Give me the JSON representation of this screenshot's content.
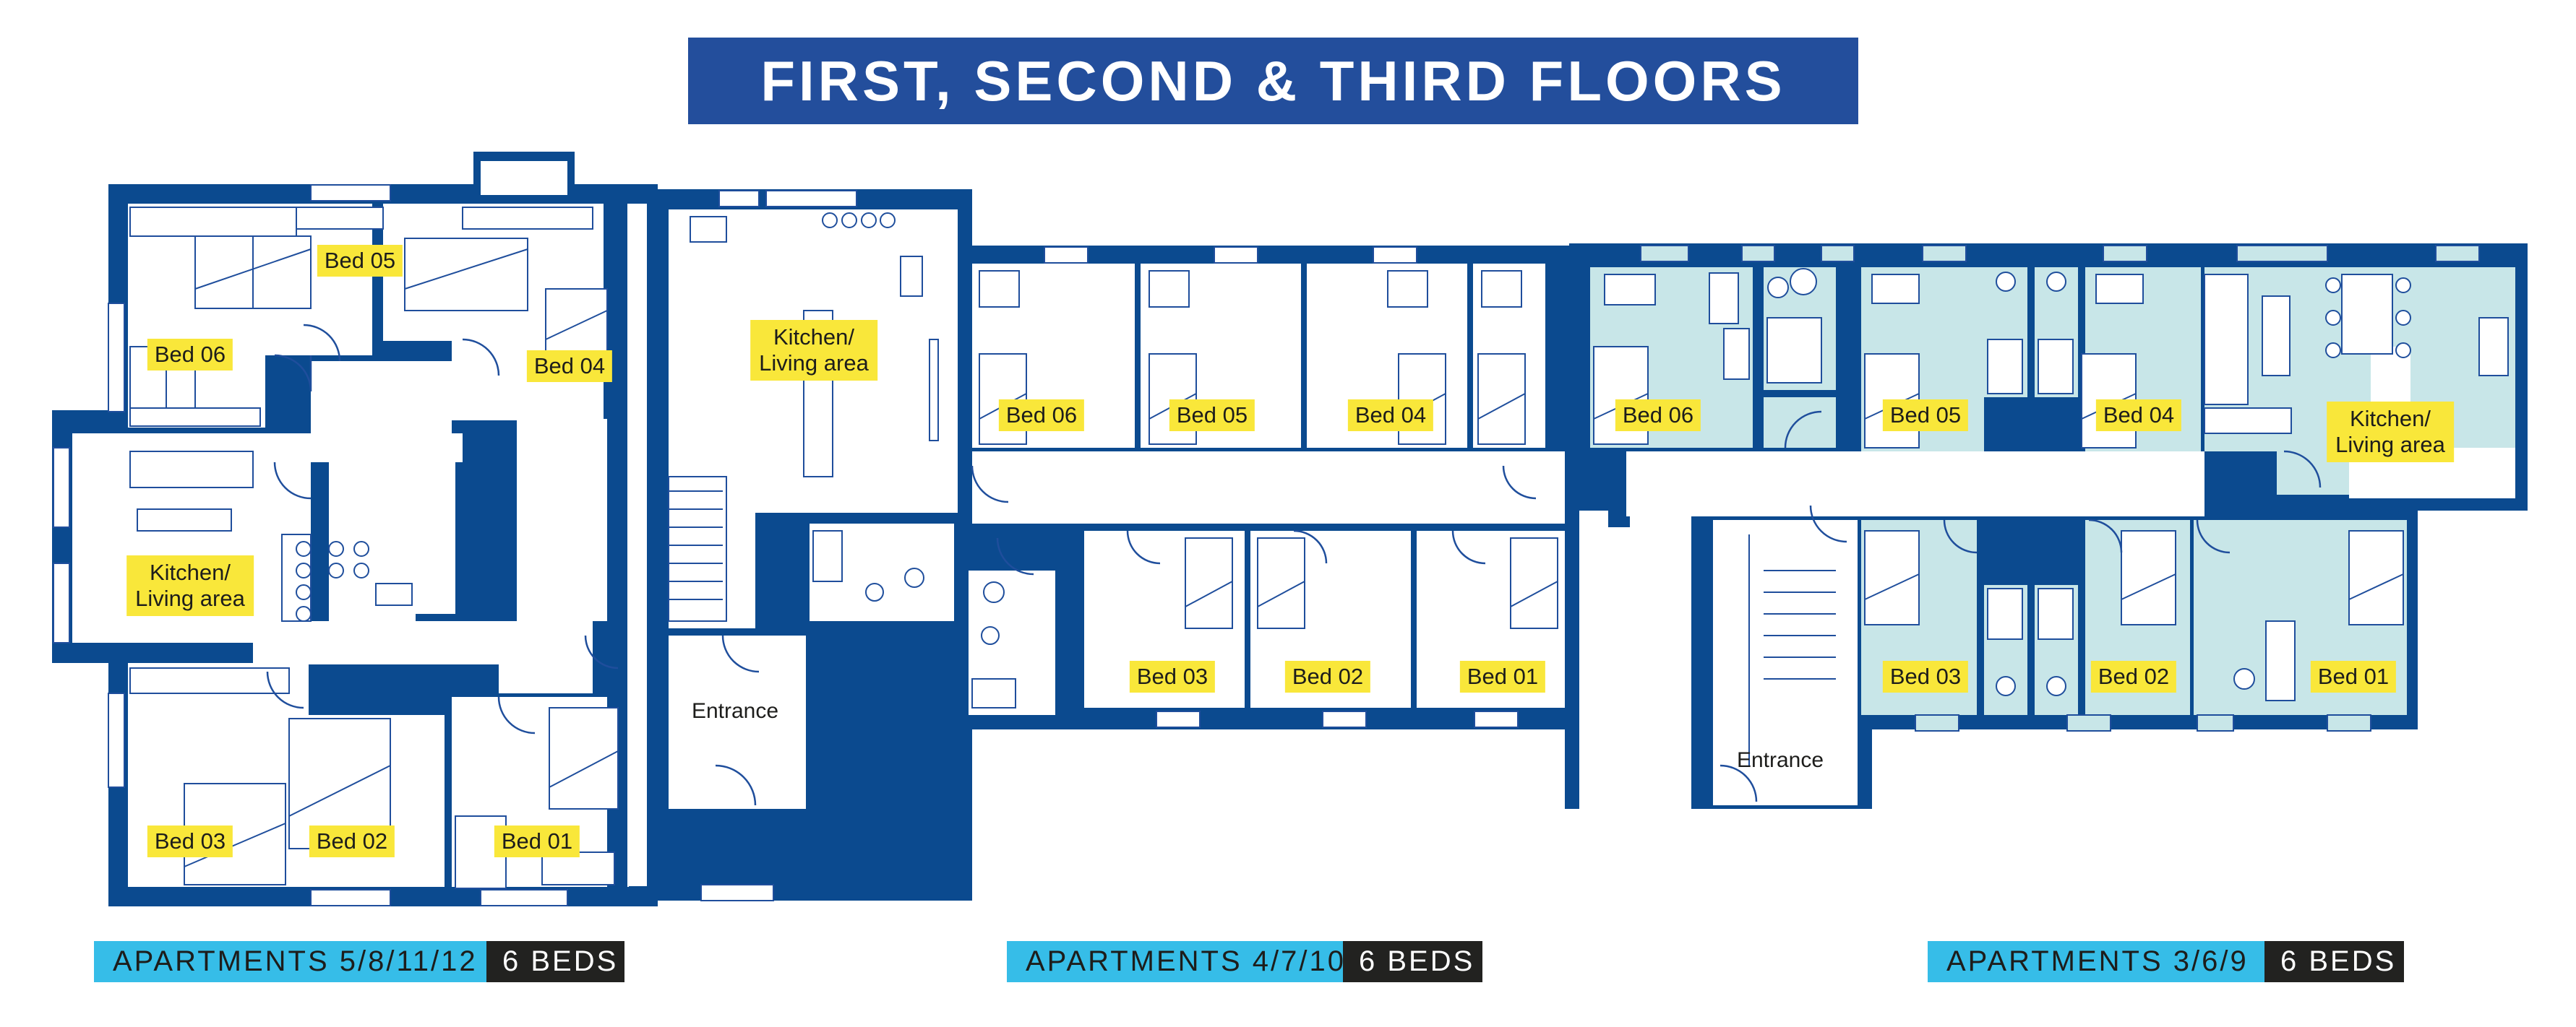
{
  "title": "FIRST, SECOND & THIRD FLOORS",
  "colors": {
    "wall": "#0b4a8f",
    "title_bg": "#234e9c",
    "label_bg": "#f9e73a",
    "apartment_tag": "#36bde8",
    "beds_tag": "#222220",
    "highlight_fill": "#c8e6e8"
  },
  "buildings": [
    {
      "id": "west",
      "apartments_label": "APARTMENTS 5/8/11/12",
      "beds_label": "6 BEDS",
      "rooms": [
        "Bed 06",
        "Bed 05",
        "Bed 04",
        "Kitchen/\nLiving area",
        "Bed 03",
        "Bed 02",
        "Bed 01"
      ]
    },
    {
      "id": "middle",
      "apartments_label": "APARTMENTS 4/7/10",
      "beds_label": "6 BEDS",
      "rooms": [
        "Kitchen/\nLiving area",
        "Bed 06",
        "Bed 05",
        "Bed 04",
        "Bed 03",
        "Bed 02",
        "Bed 01"
      ],
      "entrance": "Entrance"
    },
    {
      "id": "east",
      "apartments_label": "APARTMENTS 3/6/9",
      "beds_label": "6 BEDS",
      "rooms": [
        "Bed 06",
        "Bed 05",
        "Bed 04",
        "Kitchen/\nLiving area",
        "Bed 03",
        "Bed 02",
        "Bed 01"
      ],
      "entrance": "Entrance"
    }
  ]
}
